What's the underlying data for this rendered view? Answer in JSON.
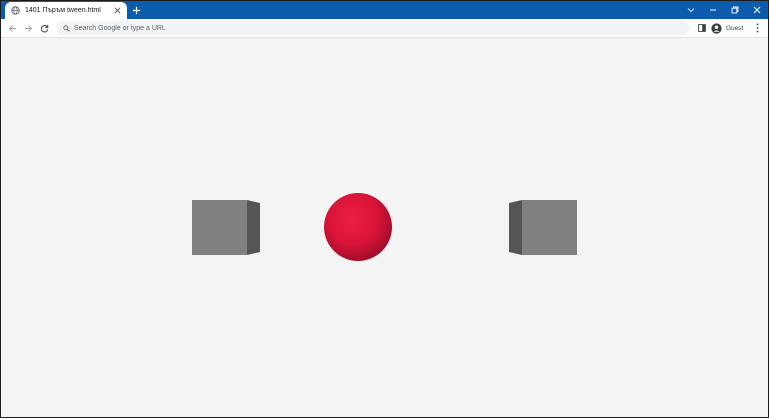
{
  "browser": {
    "tab": {
      "title": "1401 Пъръм tween.html",
      "favicon": "globe-icon",
      "close_icon": "close-icon"
    },
    "new_tab_icon": "plus-icon",
    "window_controls": [
      "chevron-down-icon",
      "minimize-icon",
      "restore-icon",
      "close-icon"
    ],
    "nav": [
      "back-arrow-icon",
      "forward-arrow-icon",
      "reload-icon"
    ],
    "omnibox": {
      "placeholder": "Search Google or type a URL",
      "icon": "search-icon"
    },
    "side_panel_icon": "side-panel-icon",
    "profile": {
      "label": "Guest",
      "icon": "avatar-icon"
    },
    "menu_icon": "kebab-menu-icon"
  },
  "scene": {
    "background": "#f4f4f4",
    "objects": [
      {
        "name": "left-cube",
        "shape": "cube",
        "color": "#808080"
      },
      {
        "name": "center-sphere",
        "shape": "sphere",
        "color": "#dc143c"
      },
      {
        "name": "right-cube",
        "shape": "cube",
        "color": "#808080"
      }
    ]
  },
  "colors": {
    "titlebar": "#0b5cad",
    "cube_face": "#808080",
    "cube_side": "#555555",
    "sphere": "#dc143c"
  }
}
